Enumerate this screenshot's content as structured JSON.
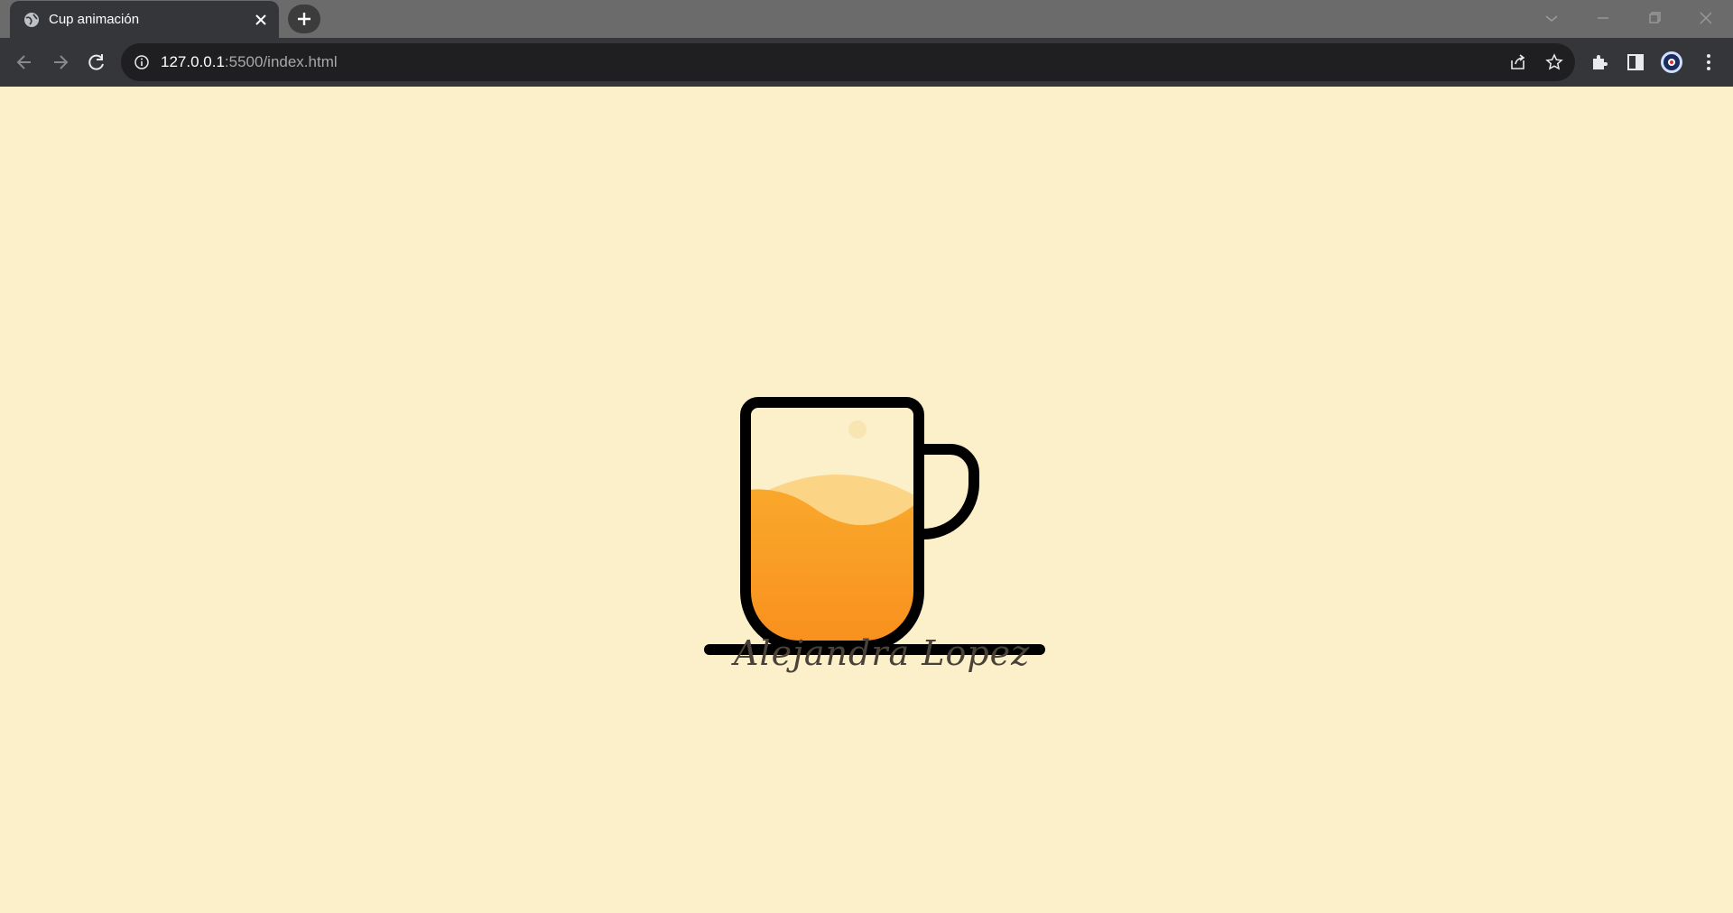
{
  "browser": {
    "tab": {
      "title": "Cup animación",
      "favicon": "globe-icon"
    },
    "address": {
      "host": "127.0.0.1",
      "rest": ":5500/index.html"
    },
    "colors": {
      "tabstrip": "#6b6b6b",
      "toolbar": "#35363a",
      "omnibox": "#1f1f21"
    }
  },
  "page": {
    "background": "#fbf0c9",
    "signature": "Alejandra Lopez",
    "cup": {
      "outline_color": "#000000",
      "liquid_color_top": "#f9a52a",
      "liquid_color_bottom": "#f98e1c",
      "wave_color": "#fcd486",
      "bubble_color": "#f7e6b2"
    }
  }
}
